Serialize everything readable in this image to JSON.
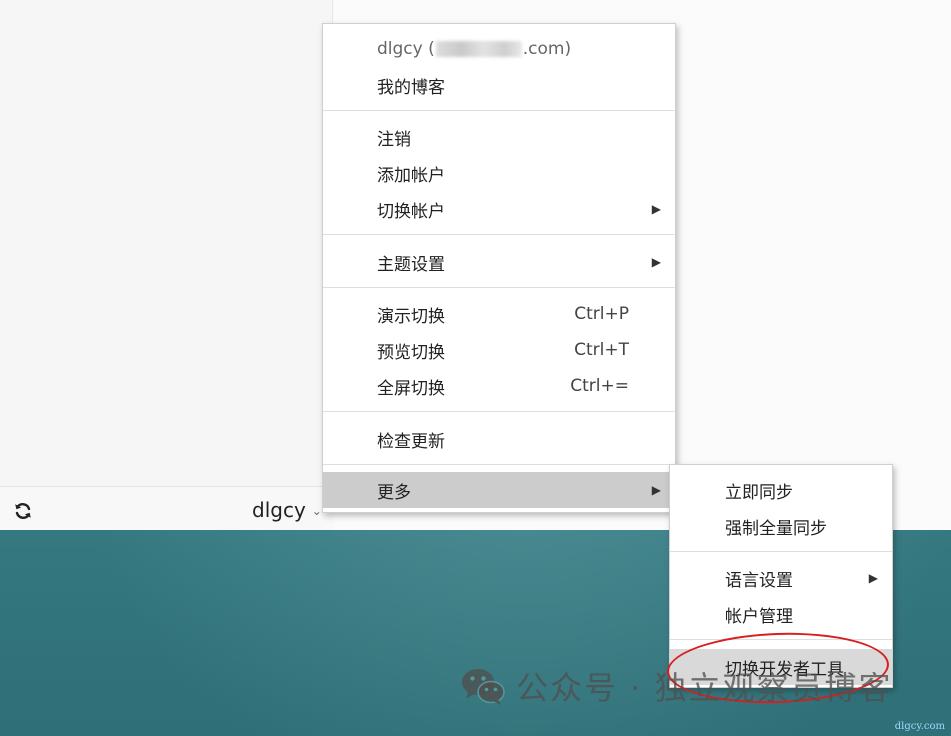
{
  "app": {
    "account_name": "dlgcy",
    "sync_icon": "refresh-icon",
    "account_chevron": "chevron-down-icon"
  },
  "main_menu": {
    "account_email_prefix": "dlgcy (",
    "account_email_suffix": ".com)",
    "items": [
      {
        "label": "我的博客"
      },
      {
        "label": "注销"
      },
      {
        "label": "添加帐户"
      },
      {
        "label": "切换帐户",
        "submenu": true
      },
      {
        "label": "主题设置",
        "submenu": true
      },
      {
        "label": "演示切换",
        "shortcut": "Ctrl+P"
      },
      {
        "label": "预览切换",
        "shortcut": "Ctrl+T"
      },
      {
        "label": "全屏切换",
        "shortcut": "Ctrl+="
      },
      {
        "label": "检查更新"
      },
      {
        "label": "更多",
        "submenu": true,
        "state": "active"
      }
    ]
  },
  "sub_menu": {
    "items": [
      {
        "label": "立即同步"
      },
      {
        "label": "强制全量同步"
      },
      {
        "label": "语言设置",
        "submenu": true
      },
      {
        "label": "帐户管理"
      },
      {
        "label": "切换开发者工具",
        "state": "hover"
      }
    ]
  },
  "annotation": {
    "color": "#d81e1e",
    "shape": "ellipse"
  },
  "watermark": {
    "text": "公众号 · 独立观察员博客",
    "icon": "wechat-icon",
    "site": "dlgcy.com"
  }
}
